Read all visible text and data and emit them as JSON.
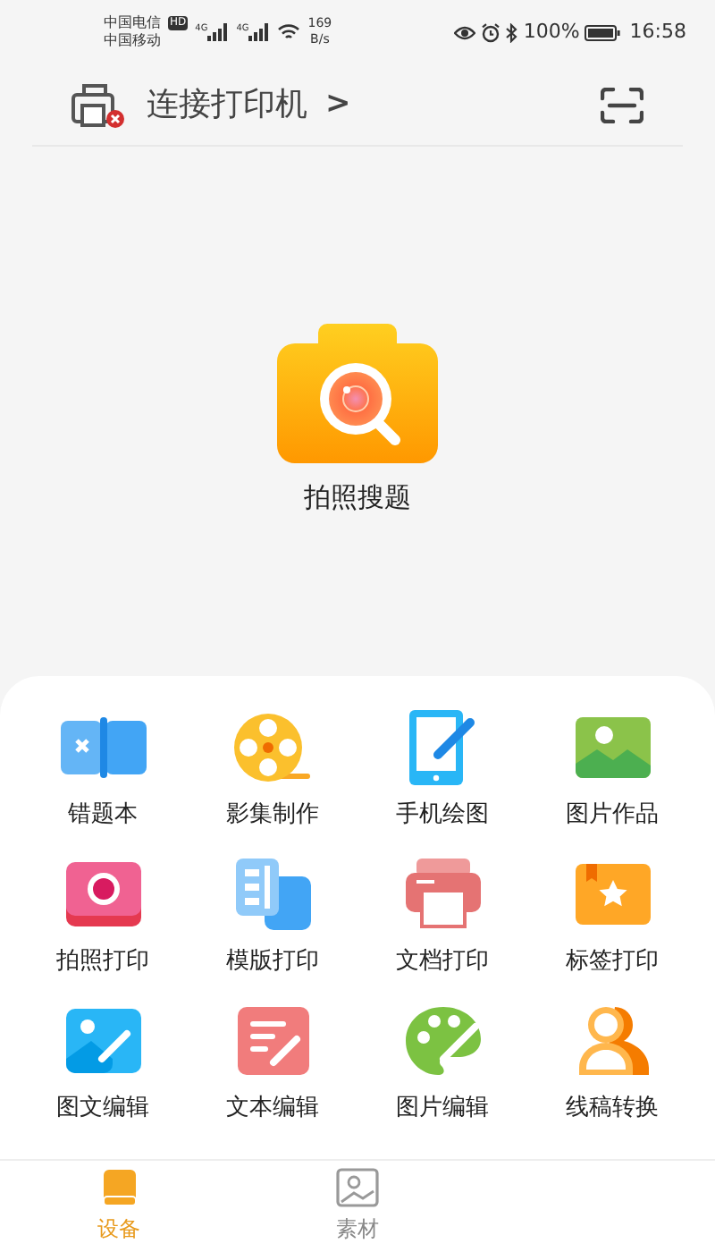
{
  "status_bar": {
    "carrier_1": "中国电信",
    "carrier_2": "中国移动",
    "hd": "HD",
    "net_1": "4G",
    "net_2": "4G",
    "speed": "169",
    "speed_unit": "B/s",
    "battery": "100%",
    "time": "16:58"
  },
  "header": {
    "title": "连接打印机",
    "chevron": ">"
  },
  "main_action": {
    "label": "拍照搜题"
  },
  "tools": [
    {
      "label": "错题本"
    },
    {
      "label": "影集制作"
    },
    {
      "label": "手机绘图"
    },
    {
      "label": "图片作品"
    },
    {
      "label": "拍照打印"
    },
    {
      "label": "模版打印"
    },
    {
      "label": "文档打印"
    },
    {
      "label": "标签打印"
    },
    {
      "label": "图文编辑"
    },
    {
      "label": "文本编辑"
    },
    {
      "label": "图片编辑"
    },
    {
      "label": "线稿转换"
    }
  ],
  "bottom_nav": [
    {
      "label": "设备",
      "selected": true
    },
    {
      "label": "素材",
      "selected": false
    }
  ]
}
